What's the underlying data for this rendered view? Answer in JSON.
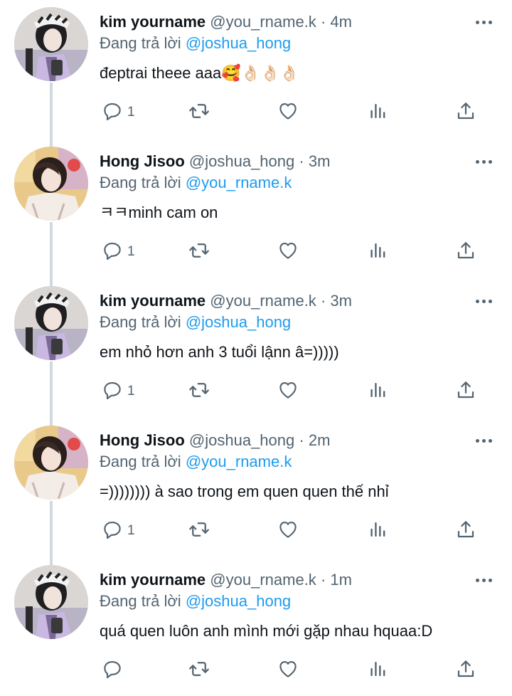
{
  "colors": {
    "link": "#1d9bf0",
    "secondary_text": "#536471",
    "primary_text": "#0f1419",
    "thread_line": "#cfd9de"
  },
  "icons": {
    "reply": "reply-icon",
    "retweet": "retweet-icon",
    "like": "heart-icon",
    "views": "views-icon",
    "share": "share-icon",
    "more": "more-icon"
  },
  "tweets": [
    {
      "display_name": "kim yourname",
      "handle": "@you_rname.k",
      "dot": "·",
      "time": "4m",
      "replying_prefix": "Đang trả lời",
      "replying_to": "@joshua_hong",
      "text": "đeptrai theee aaa🥰👌🏻👌🏻👌🏻",
      "reply_count": "1",
      "avatar": "kim"
    },
    {
      "display_name": "Hong Jisoo",
      "handle": "@joshua_hong",
      "dot": "·",
      "time": "3m",
      "replying_prefix": "Đang trả lời",
      "replying_to": "@you_rname.k",
      "text": "ㅋㅋminh cam on",
      "reply_count": "1",
      "avatar": "hong"
    },
    {
      "display_name": "kim yourname",
      "handle": "@you_rname.k",
      "dot": "·",
      "time": "3m",
      "replying_prefix": "Đang trả lời",
      "replying_to": "@joshua_hong",
      "text": "em nhỏ hơn anh 3 tuổi lậnn â=)))))",
      "reply_count": "1",
      "avatar": "kim"
    },
    {
      "display_name": "Hong Jisoo",
      "handle": "@joshua_hong",
      "dot": "·",
      "time": "2m",
      "replying_prefix": "Đang trả lời",
      "replying_to": "@you_rname.k",
      "text": "=)))))))) à sao trong em quen quen thế nhỉ",
      "reply_count": "1",
      "avatar": "hong"
    },
    {
      "display_name": "kim yourname",
      "handle": "@you_rname.k",
      "dot": "·",
      "time": "1m",
      "replying_prefix": "Đang trả lời",
      "replying_to": "@joshua_hong",
      "text": "quá quen luôn anh mình mới gặp nhau hquaa:D",
      "reply_count": "",
      "avatar": "kim"
    }
  ]
}
